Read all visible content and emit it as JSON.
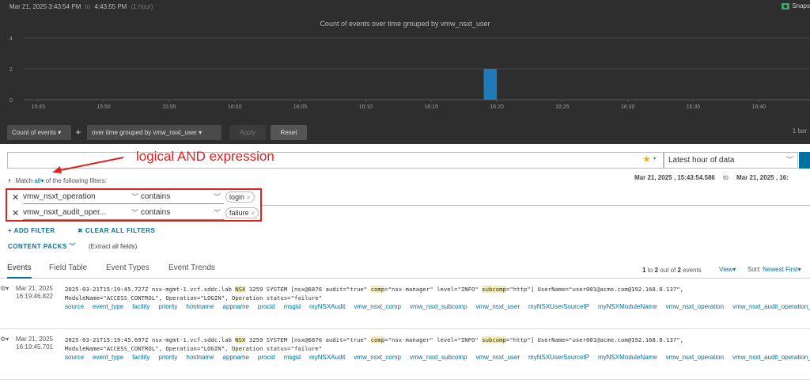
{
  "header": {
    "start_time": "Mar 21, 2025  3:43:54 PM",
    "to": "to",
    "end_time": "4:43:55 PM",
    "duration": "(1 hour)",
    "snapshot": "Snaps"
  },
  "chart_data": {
    "type": "bar",
    "title": "Count of events over time grouped by vmw_nsxt_user",
    "x": [
      "15:45",
      "15:50",
      "15:55",
      "16:00",
      "16:05",
      "16:10",
      "16:15",
      "16:20",
      "16:25",
      "16:30",
      "16:35",
      "16:40"
    ],
    "y_ticks": [
      0,
      2,
      4
    ],
    "ylim": [
      0,
      4
    ],
    "series": [
      {
        "time": "16:19",
        "values": [
          2
        ]
      }
    ],
    "bar_color": "#1f7ab8",
    "grid": true
  },
  "chart_toolbar": {
    "count_dropdown": "Count of events",
    "plus": "+",
    "group_dropdown": "over time grouped by vmw_nsxt_user",
    "apply": "Apply",
    "reset": "Reset",
    "bar_info": "1 bar"
  },
  "query": {
    "placeholder": "",
    "time_range": "Latest hour of data",
    "annotation": "logical AND expression",
    "match_prefix": "Match",
    "match_value": "all",
    "match_suffix": "of the following filters:",
    "range_start": "Mar 21, 2025 , 15:43:54.586",
    "range_to": "to",
    "range_end": "Mar 21, 2025 , 16:"
  },
  "filters": [
    {
      "field": "vmw_nsxt_operation",
      "operator": "contains",
      "value": "login"
    },
    {
      "field": "vmw_nsxt_audit_oper...",
      "operator": "contains",
      "value": "failure"
    }
  ],
  "actions": {
    "add_filter": "+ ADD FILTER",
    "clear_filters": "✖ CLEAR ALL FILTERS",
    "content_packs": "CONTENT PACKS",
    "extract": "(Extract all fields)"
  },
  "tabs": [
    "Events",
    "Field Table",
    "Event Types",
    "Event Trends"
  ],
  "results": {
    "count_prefix": "1",
    "count_mid": "to",
    "count_a": "2",
    "count_mid2": "out of",
    "count_b": "2",
    "count_suffix": "events",
    "view": "View",
    "sort_label": "Sort:",
    "sort_value": "Newest First"
  },
  "events": [
    {
      "date": "Mar 21, 2025",
      "time": "16:19:46.822",
      "line1_a": "2025-03-21T15:19:45.727Z nsx-mgmt-1.vcf.sddc.lab ",
      "nsx": "NSX",
      "line1_b": " 3259 SYSTEM [nsx@6876 audit=\"true\" ",
      "comp": "comp",
      "line1_c": "=\"nsx-manager\" level=\"INFO\" ",
      "subcomp": "subcomp",
      "line1_d": "=\"http\"] UserName=\"user001@acme.com@192.168.0.137\",",
      "line2": "ModuleName=\"ACCESS_CONTROL\", Operation=\"LOGIN\", Operation status=\"failure\""
    },
    {
      "date": "Mar 21, 2025",
      "time": "16:19:45.701",
      "line1_a": "2025-03-21T15:19:45.697Z nsx-mgmt-1.vcf.sddc.lab ",
      "nsx": "NSX",
      "line1_b": " 3259 SYSTEM [nsx@6876 audit=\"true\" ",
      "comp": "comp",
      "line1_c": "=\"nsx-manager\" level=\"INFO\" ",
      "subcomp": "subcomp",
      "line1_d": "=\"http\"] UserName=\"user001@acme.com@192.168.0.137\",",
      "line2": "ModuleName=\"ACCESS_CONTROL\", Operation=\"LOGIN\", Operation status=\"failure\""
    }
  ],
  "event_fields": [
    "source",
    "event_type",
    "facility",
    "priority",
    "hostname",
    "appname",
    "procid",
    "msgid",
    "myNSXAudit",
    "vmw_nsxt_comp",
    "vmw_nsxt_subcomp",
    "vmw_nsxt_user",
    "myNSXUserSourceIP",
    "myNSXModuleName",
    "vmw_nsxt_operation",
    "vmw_nsxt_audit_operation_status"
  ]
}
